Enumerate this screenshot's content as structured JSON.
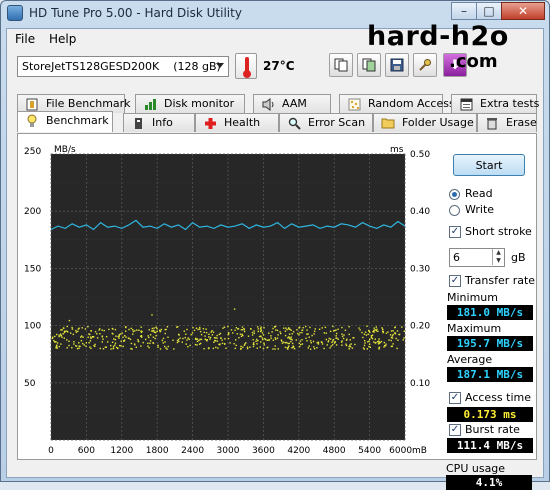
{
  "window": {
    "title": "HD Tune Pro 5.00 - Hard Disk Utility",
    "controls": {
      "minimize": "–",
      "maximize": "□",
      "close": "✕"
    }
  },
  "menu": {
    "file": "File",
    "help": "Help"
  },
  "toolbar": {
    "drive": "StoreJetTS128GESD200K    (128 gB)",
    "temperature": "27°C",
    "exit_label": "⬇",
    "icons": [
      "copy-icon",
      "copy-image-icon",
      "save-icon",
      "options-icon",
      "exit-icon"
    ]
  },
  "watermark": {
    "top": "hard-h2o",
    "bottom": ".com"
  },
  "tabs": {
    "top": [
      {
        "label": "File Benchmark",
        "icon": "file-benchmark-icon"
      },
      {
        "label": "Disk monitor",
        "icon": "disk-monitor-icon"
      },
      {
        "label": "AAM",
        "icon": "speaker-icon"
      },
      {
        "label": "Random Access",
        "icon": "random-access-icon"
      },
      {
        "label": "Extra tests",
        "icon": "extra-tests-icon"
      }
    ],
    "bottom": [
      {
        "label": "Benchmark",
        "icon": "benchmark-icon",
        "active": true
      },
      {
        "label": "Info",
        "icon": "info-icon"
      },
      {
        "label": "Health",
        "icon": "health-icon"
      },
      {
        "label": "Error Scan",
        "icon": "error-scan-icon"
      },
      {
        "label": "Folder Usage",
        "icon": "folder-icon"
      },
      {
        "label": "Erase",
        "icon": "trash-icon"
      }
    ]
  },
  "controls": {
    "start": "Start",
    "read": "Read",
    "write": "Write",
    "mode": "read",
    "short_stroke": "Short stroke",
    "short_stroke_checked": true,
    "stroke_value": "6",
    "stroke_unit": "gB",
    "transfer_rate": "Transfer rate",
    "transfer_rate_checked": true,
    "minimum_label": "Minimum",
    "minimum": "181.0 MB/s",
    "maximum_label": "Maximum",
    "maximum": "195.7 MB/s",
    "average_label": "Average",
    "average": "187.1 MB/s",
    "access_time": "Access time",
    "access_time_checked": true,
    "access_value": "0.173 ms",
    "burst_rate": "Burst rate",
    "burst_rate_checked": true,
    "burst_value": "111.4 MB/s",
    "cpu_label": "CPU usage",
    "cpu_value": "4.1%"
  },
  "chart_data": {
    "type": "line",
    "y_left_label": "MB/s",
    "y_right_label": "ms",
    "x_unit": "mB",
    "y_left_ticks": [
      "250",
      "200",
      "150",
      "100",
      "50"
    ],
    "y_right_ticks": [
      "0.50",
      "0.40",
      "0.30",
      "0.20",
      "0.10"
    ],
    "x_ticks": [
      "0",
      "600",
      "1200",
      "1800",
      "2400",
      "3000",
      "3600",
      "4200",
      "4800",
      "5400",
      "6000mB"
    ],
    "xlim": [
      0,
      6000
    ],
    "ylim_left": [
      0,
      250
    ],
    "ylim_right": [
      0,
      0.5
    ],
    "grid": true,
    "transfer_series": {
      "name": "Transfer rate",
      "color": "#2fb6e0",
      "x": [
        0,
        120,
        240,
        360,
        480,
        600,
        720,
        840,
        960,
        1080,
        1200,
        1320,
        1440,
        1560,
        1680,
        1800,
        1920,
        2040,
        2160,
        2280,
        2400,
        2520,
        2640,
        2760,
        2880,
        3000,
        3120,
        3240,
        3360,
        3480,
        3600,
        3720,
        3840,
        3960,
        4080,
        4200,
        4320,
        4440,
        4560,
        4680,
        4800,
        4920,
        5040,
        5160,
        5280,
        5400,
        5520,
        5640,
        5760,
        5880,
        6000
      ],
      "y": [
        184,
        187,
        185,
        189,
        186,
        188,
        184,
        190,
        186,
        187,
        185,
        188,
        192,
        186,
        187,
        185,
        189,
        186,
        188,
        184,
        190,
        186,
        187,
        185,
        188,
        186,
        187,
        189,
        185,
        188,
        186,
        187,
        190,
        185,
        189,
        186,
        187,
        188,
        185,
        187,
        186,
        189,
        188,
        186,
        190,
        187,
        185,
        188,
        186,
        191,
        187
      ]
    },
    "access_series": {
      "name": "Access time",
      "color": "#e6e63a",
      "range_ms": [
        0.16,
        0.2
      ],
      "outliers_ms": [
        0.21,
        0.22,
        0.23
      ]
    }
  }
}
